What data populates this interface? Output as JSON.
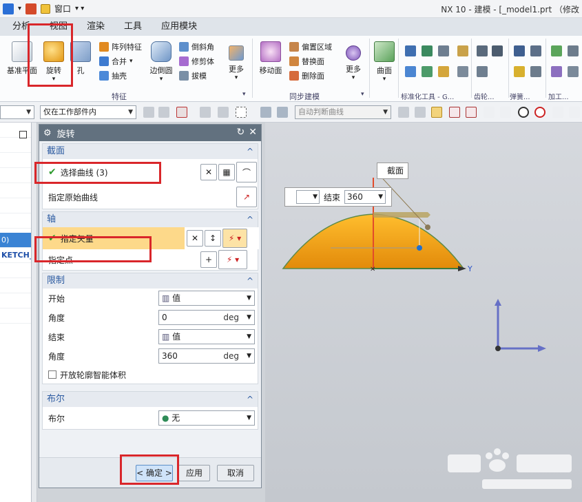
{
  "window": {
    "title": "NX 10 - 建模 - [_model1.prt （修改"
  },
  "quick_access": {
    "window_menu": "窗口"
  },
  "menu": {
    "tabs": [
      "分析",
      "视图",
      "渲染",
      "工具",
      "应用模块"
    ]
  },
  "ribbon": {
    "features": {
      "datum_plane": "基准平面",
      "revolve": "旋转",
      "hole": "孔",
      "pattern_feature": "阵列特征",
      "combine": "合并",
      "shell": "抽壳",
      "edge_blend": "边倒圆",
      "chamfer": "倒斜角",
      "trim_body": "修剪体",
      "draft": "拔模",
      "more": "更多",
      "group_label": "特征"
    },
    "sync": {
      "move_face": "移动面",
      "offset_region": "偏置区域",
      "replace_face": "替换面",
      "delete_face": "删除面",
      "more": "更多",
      "group_label": "同步建模"
    },
    "surface": {
      "label": "曲面"
    },
    "groups": {
      "standard_tools": "标准化工具 - G...",
      "gear": "齿轮...",
      "spring": "弹簧...",
      "machining": "加工..."
    }
  },
  "selection_bar": {
    "filter_placeholder": "",
    "scope": "仅在工作部件内",
    "curve_rule": "自动判断曲线"
  },
  "navigator": {
    "rows": [
      "",
      "",
      "",
      "",
      "",
      "",
      "",
      "",
      "0)",
      "KETCH_",
      "",
      "",
      "",
      ""
    ]
  },
  "dialog": {
    "title": "旋转",
    "section": {
      "label": "截面",
      "select_curve": "选择曲线 (3)",
      "specify_origin_curve": "指定原始曲线"
    },
    "axis": {
      "label": "轴",
      "specify_vector": "指定矢量",
      "specify_point": "指定点"
    },
    "limits": {
      "label": "限制",
      "start_label": "开始",
      "start_value": "值",
      "start_angle_label": "角度",
      "start_angle": "0",
      "end_label": "结束",
      "end_value": "值",
      "end_angle_label": "角度",
      "end_angle": "360",
      "unit": "deg",
      "open_profile": "开放轮廓智能体积"
    },
    "boolean": {
      "label": "布尔",
      "field_label": "布尔",
      "value": "无"
    },
    "buttons": {
      "ok": "< 确定 >",
      "apply": "应用",
      "cancel": "取消"
    }
  },
  "viewport": {
    "section_tag": "截面",
    "end_label": "结束",
    "end_value": "360",
    "axis_y": "Y"
  },
  "colors": {
    "highlight": "#fdd98a",
    "red_box": "#d9262a",
    "dome": "#f2a516",
    "title": "#62717f"
  }
}
